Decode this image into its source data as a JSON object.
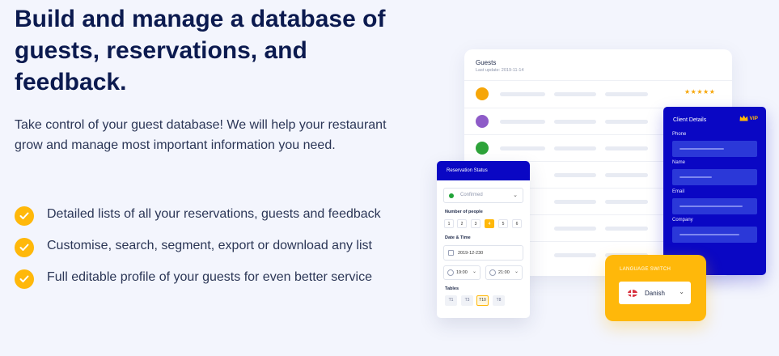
{
  "hero": {
    "title": "Build and manage a database of guests, reservations, and feedback.",
    "intro": "Take control of your guest database! We will help your restaurant grow and manage most important information you need.",
    "features": [
      "Detailed lists of all your reservations, guests and feedback",
      "Customise, search, segment, export or download any list",
      "Full editable profile of your guests for even better service"
    ]
  },
  "guests_card": {
    "title": "Guests",
    "last_update": "Last update: 2019-11-14",
    "rating": "★★★★★",
    "dot_colors": [
      "#f6a609",
      "#8e5bc8",
      "#2ea33a"
    ]
  },
  "client_details": {
    "title": "Client Details",
    "badge": "VIP",
    "fields": [
      "Phone",
      "Name",
      "Email",
      "Company"
    ]
  },
  "reservation": {
    "title": "Reservation Status",
    "status": "Confirmed",
    "people_label": "Number of people",
    "people": [
      "1",
      "2",
      "3",
      "4",
      "5",
      "6"
    ],
    "selected_people": "4",
    "datetime_label": "Date & Time",
    "date": "2019-12-230",
    "time_from": "19:00",
    "time_to": "21:00",
    "tables_label": "Tables",
    "tables": [
      "T1",
      "T3",
      "T10",
      "T8"
    ],
    "selected_table": "T10"
  },
  "language": {
    "title": "LANGUAGE SWITCH",
    "selected": "Danish"
  },
  "colors": {
    "navy": "#0b1a4f",
    "accent_blue": "#0a07c4",
    "accent_yellow": "#ffb80a",
    "background": "#f3f5fd"
  }
}
